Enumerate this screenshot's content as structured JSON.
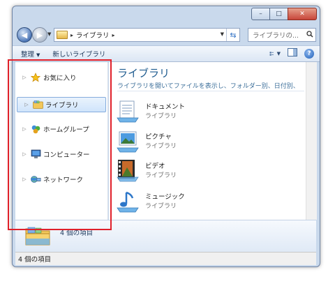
{
  "window": {
    "caption": {
      "minimize": "–",
      "maximize": "□",
      "close": "✕"
    }
  },
  "nav": {
    "back_icon": "back-arrow-icon",
    "forward_icon": "forward-arrow-icon",
    "address_path": [
      "ライブラリ"
    ],
    "search_placeholder": "ライブラリの...",
    "refresh_icon": "refresh-icon"
  },
  "toolbar": {
    "organize_label": "整理",
    "new_library_label": "新しいライブラリ"
  },
  "navpane": {
    "items": [
      {
        "label": "お気に入り",
        "icon": "star-icon",
        "selected": false
      },
      {
        "label": "ライブラリ",
        "icon": "library-icon",
        "selected": true
      },
      {
        "label": "ホームグループ",
        "icon": "homegroup-icon",
        "selected": false
      },
      {
        "label": "コンピューター",
        "icon": "computer-icon",
        "selected": false
      },
      {
        "label": "ネットワーク",
        "icon": "network-icon",
        "selected": false
      }
    ]
  },
  "content": {
    "title": "ライブラリ",
    "subtitle": "ライブラリを開いてファイルを表示し、フォルダー別、日付別、",
    "items": [
      {
        "name": "ドキュメント",
        "type": "ライブラリ",
        "icon": "documents-library-icon"
      },
      {
        "name": "ピクチャ",
        "type": "ライブラリ",
        "icon": "pictures-library-icon"
      },
      {
        "name": "ビデオ",
        "type": "ライブラリ",
        "icon": "videos-library-icon"
      },
      {
        "name": "ミュージック",
        "type": "ライブラリ",
        "icon": "music-library-icon"
      }
    ]
  },
  "details": {
    "count": "4 個の項目"
  },
  "status": {
    "text": "4 個の項目"
  },
  "colors": {
    "highlight": "#e0202a",
    "title": "#1e5b8f",
    "frame": "#c9d9ec"
  }
}
